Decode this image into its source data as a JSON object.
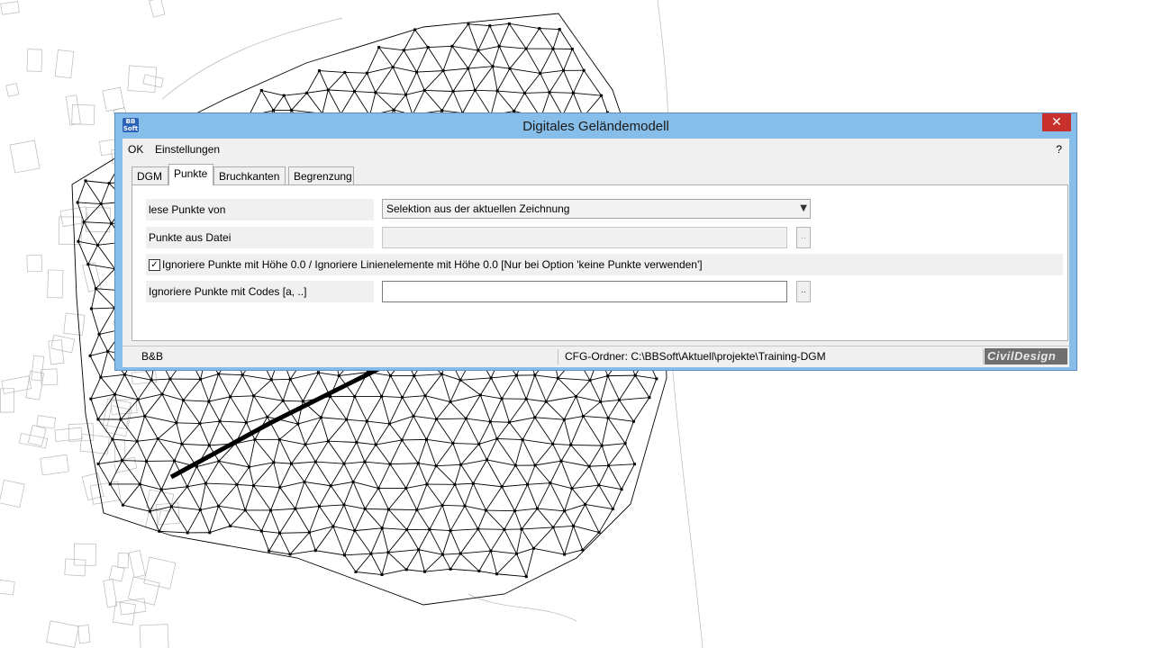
{
  "window": {
    "title": "Digitales Geländemodell",
    "logo_text": "BB Soft"
  },
  "menu": {
    "ok": "OK",
    "settings": "Einstellungen",
    "help": "?"
  },
  "tabs": [
    {
      "label": "DGM"
    },
    {
      "label": "Punkte"
    },
    {
      "label": "Bruchkanten"
    },
    {
      "label": "Begrenzung"
    }
  ],
  "active_tab": "Punkte",
  "form": {
    "read_points_label": "lese Punkte von",
    "read_points_value": "Selektion aus der aktuellen Zeichnung",
    "points_file_label": "Punkte aus Datei",
    "points_file_value": "",
    "ignore_zero_checked": true,
    "ignore_zero_label": "Ignoriere Punkte mit Höhe 0.0 / Ignoriere Linienelemente mit Höhe 0.0 [Nur bei Option 'keine Punkte verwenden']",
    "ignore_codes_label": "Ignoriere Punkte mit Codes [a, ..]",
    "ignore_codes_value": "",
    "browse_label": ".."
  },
  "status": {
    "left": "B&B",
    "cfg": "CFG-Ordner:  C:\\BBSoft\\Aktuell\\projekte\\Training-DGM",
    "brand": "CivilDesign"
  },
  "colors": {
    "titlebar": "#87bde9",
    "close": "#c7302b",
    "panel_bg": "#f0f0f0"
  }
}
